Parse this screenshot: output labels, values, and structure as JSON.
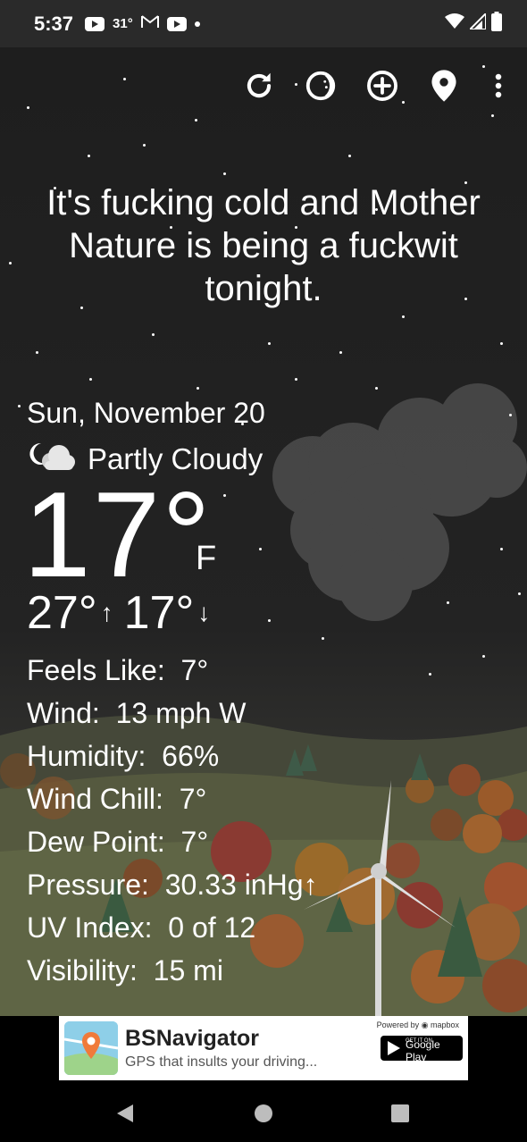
{
  "status_bar": {
    "time": "5:37",
    "temperature": "31°",
    "icons": [
      "youtube-icon",
      "gmail-icon",
      "youtube-icon",
      "dot-icon",
      "wifi-icon",
      "signal-icon",
      "battery-icon"
    ]
  },
  "toolbar": {
    "icons": [
      "refresh-icon",
      "theme-icon",
      "add-location-icon",
      "location-pin-icon",
      "more-vert-icon"
    ]
  },
  "headline": "It's fucking cold and Mother Nature is being a fuckwit tonight.",
  "weather": {
    "date": "Sun, November 20",
    "condition": "Partly Cloudy",
    "condition_icon": "partly-cloudy-night-icon",
    "temperature": "17°",
    "unit": "F",
    "high": "27°",
    "low": "17°",
    "details": [
      {
        "label": "Feels Like:",
        "value": "7°"
      },
      {
        "label": "Wind:",
        "value": "13 mph W"
      },
      {
        "label": "Humidity:",
        "value": "66%"
      },
      {
        "label": "Wind Chill:",
        "value": "7°"
      },
      {
        "label": "Dew Point:",
        "value": "7°"
      },
      {
        "label": "Pressure:",
        "value": "30.33 inHg↑"
      },
      {
        "label": "UV Index:",
        "value": "0 of 12"
      },
      {
        "label": "Visibility:",
        "value": "15 mi"
      }
    ]
  },
  "ad": {
    "title": "BSNavigator",
    "subtitle": "GPS that insults your driving...",
    "powered_by": "Powered by ◉ mapbox",
    "store_small": "GET IT ON",
    "store_label": "Google Play"
  },
  "colors": {
    "status_bar": "#2a2a2a",
    "sky": "#1e1e1e",
    "text": "#ffffff"
  }
}
